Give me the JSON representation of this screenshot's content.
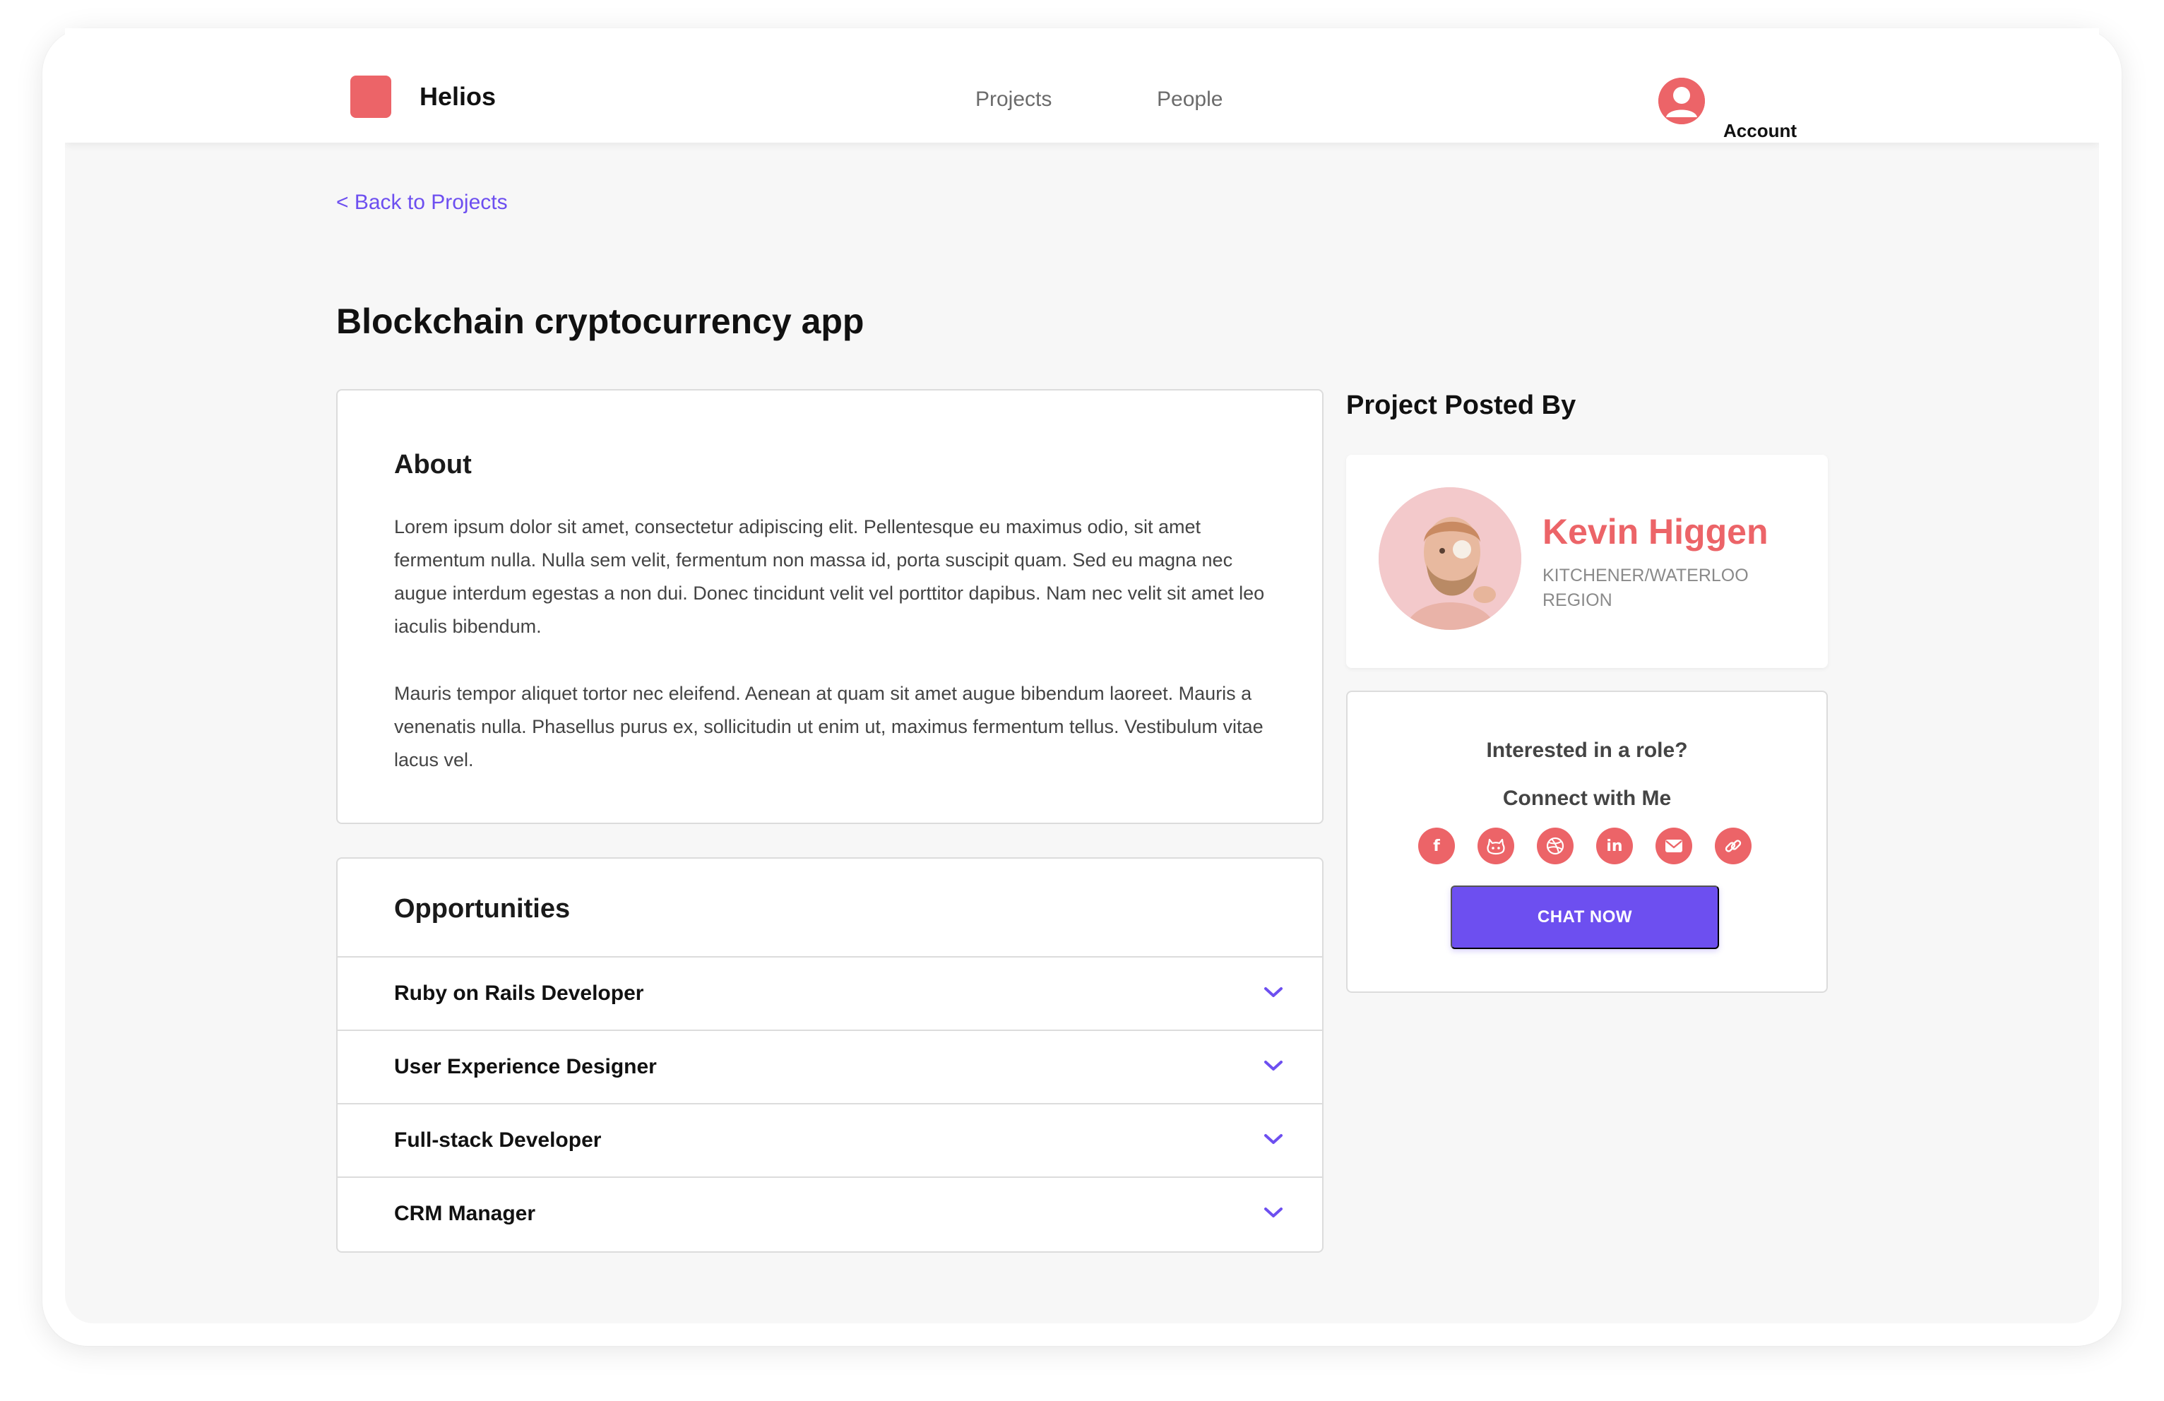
{
  "app": {
    "brand": "Helios",
    "brand_color": "#ec6468",
    "accent_color": "#6d4ff0"
  },
  "nav": {
    "links": [
      {
        "label": "Projects"
      },
      {
        "label": "People"
      }
    ],
    "account_label": "Account",
    "account_icon": "user-avatar-icon"
  },
  "back_link": "< Back to Projects",
  "project": {
    "title": "Blockchain cryptocurrency app",
    "about": {
      "heading": "About",
      "paragraphs": [
        "Lorem ipsum dolor sit amet, consectetur adipiscing elit. Pellentesque eu maximus odio, sit amet fermentum nulla. Nulla sem velit, fermentum non massa id, porta suscipit quam. Sed eu magna nec augue interdum egestas a non dui. Donec tincidunt velit vel porttitor dapibus. Nam nec velit sit amet leo iaculis bibendum.",
        "Mauris tempor aliquet tortor nec eleifend. Aenean at quam sit amet augue bibendum laoreet. Mauris a venenatis nulla. Phasellus purus ex, sollicitudin ut enim ut, maximus fermentum tellus. Vestibulum vitae lacus vel."
      ]
    },
    "opportunities": {
      "heading": "Opportunities",
      "items": [
        {
          "label": "Ruby on Rails Developer"
        },
        {
          "label": "User Experience Designer"
        },
        {
          "label": "Full-stack Developer"
        },
        {
          "label": "CRM Manager"
        }
      ]
    }
  },
  "poster": {
    "heading": "Project Posted By",
    "name": "Kevin Higgen",
    "location": "Kitchener/Waterloo Region"
  },
  "connect": {
    "interest": "Interested in a role?",
    "connect_label": "Connect with Me",
    "socials": [
      {
        "icon": "facebook-icon",
        "glyph": "f"
      },
      {
        "icon": "github-icon",
        "glyph": ""
      },
      {
        "icon": "dribbble-icon",
        "glyph": ""
      },
      {
        "icon": "linkedin-icon",
        "glyph": "in"
      },
      {
        "icon": "email-icon",
        "glyph": ""
      },
      {
        "icon": "link-icon",
        "glyph": ""
      }
    ],
    "cta": "CHAT NOW"
  }
}
